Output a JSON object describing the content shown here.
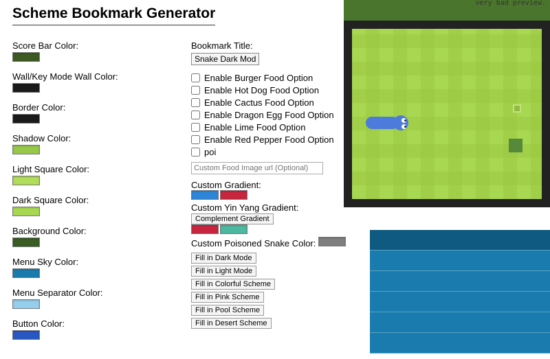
{
  "preview_caption": "very bad preview.",
  "title": "Scheme Bookmark Generator",
  "leftFields": [
    {
      "label": "Score Bar Color:",
      "color": "#3d5a22"
    },
    {
      "label": "Wall/Key Mode Wall Color:",
      "color": "#1a1a1a"
    },
    {
      "label": "Border Color:",
      "color": "#1a1a1a"
    },
    {
      "label": "Shadow Color:",
      "color": "#97c84a"
    },
    {
      "label": "Light Square Color:",
      "color": "#b2dd5a"
    },
    {
      "label": "Dark Square Color:",
      "color": "#a8d852"
    },
    {
      "label": "Background Color:",
      "color": "#3a5d24"
    },
    {
      "label": "Menu Sky Color:",
      "color": "#1a7cae"
    },
    {
      "label": "Menu Separator Color:",
      "color": "#95cdec"
    },
    {
      "label": "Button Color:",
      "color": "#2857c1"
    }
  ],
  "bookmark": {
    "label": "Bookmark Title:",
    "value": "Snake Dark Mod"
  },
  "checks": [
    {
      "label": "Enable Burger Food Option"
    },
    {
      "label": "Enable Hot Dog Food Option"
    },
    {
      "label": "Enable Cactus Food Option"
    },
    {
      "label": "Enable Dragon Egg Food Option"
    },
    {
      "label": "Enable Lime Food Option"
    },
    {
      "label": "Enable Red Pepper Food Option"
    },
    {
      "label": "poi"
    }
  ],
  "customFoodUrl": {
    "placeholder": "Custom Food Image url (Optional)"
  },
  "customGradient": {
    "label": "Custom Gradient:",
    "c1": "#2d86d8",
    "c2": "#c8263f"
  },
  "yinYang": {
    "label": "Custom Yin Yang Gradient:",
    "button": "Complement Gradient",
    "c1": "#c8263f",
    "c2": "#4cb9a0"
  },
  "poisoned": {
    "label": "Custom Poisoned Snake Color:",
    "color": "#7f7f7f"
  },
  "fillButtons": [
    "Fill in Dark Mode",
    "Fill in Light Mode",
    "Fill in Colorful Scheme",
    "Fill in Pink Scheme",
    "Fill in Pool Scheme",
    "Fill in Desert Scheme"
  ]
}
